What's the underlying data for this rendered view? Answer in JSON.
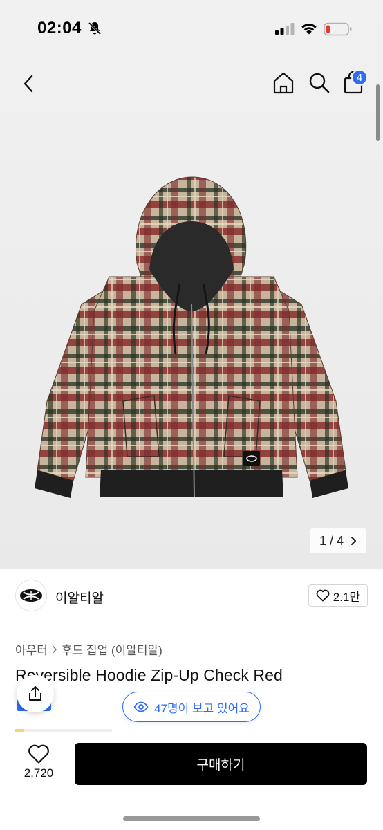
{
  "status_bar": {
    "time": "02:04"
  },
  "header": {
    "cart_count": "4"
  },
  "gallery": {
    "counter": "1 / 4"
  },
  "brand": {
    "name": "이알티알",
    "like_count": "2.1만"
  },
  "breadcrumb": {
    "category": "아우터",
    "subcategory": "후드 집업 (이알티알)"
  },
  "product": {
    "title": "Reversible Hoodie Zip-Up Check Red"
  },
  "viewers": {
    "text": "47명이 보고 있어요"
  },
  "bottom": {
    "wish_count": "2,720",
    "buy_label": "구매하기"
  },
  "colors": {
    "accent": "#2f6cf6",
    "buy_button": "#000000"
  }
}
